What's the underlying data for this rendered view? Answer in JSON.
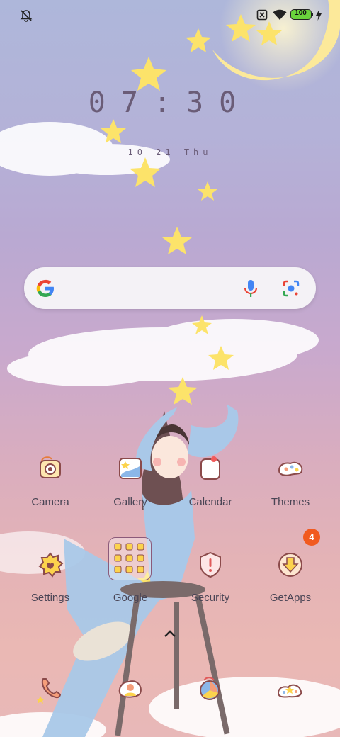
{
  "status": {
    "battery_level": "100",
    "icons": [
      "notifications-off-icon",
      "sim-none-icon",
      "wifi-icon",
      "battery-icon",
      "charging-icon"
    ]
  },
  "lockscreen": {
    "time": "07:30",
    "date": "10 21 Thu"
  },
  "search": {
    "icons": [
      "google-g-icon",
      "microphone-icon",
      "google-lens-icon"
    ]
  },
  "apps_row1": [
    {
      "label": "Camera"
    },
    {
      "label": "Gallery"
    },
    {
      "label": "Calendar"
    },
    {
      "label": "Themes"
    }
  ],
  "apps_row2": [
    {
      "label": "Settings"
    },
    {
      "label": "Google"
    },
    {
      "label": "Security"
    },
    {
      "label": "GetApps",
      "badge": "4"
    }
  ],
  "dock_icons": [
    "phone-icon",
    "contacts-icon",
    "browser-icon",
    "messages-icon"
  ],
  "colors": {
    "text": "#4a4555",
    "clock": "#6a5c77",
    "badge": "#f15a1f",
    "battery": "#6ad43c"
  }
}
